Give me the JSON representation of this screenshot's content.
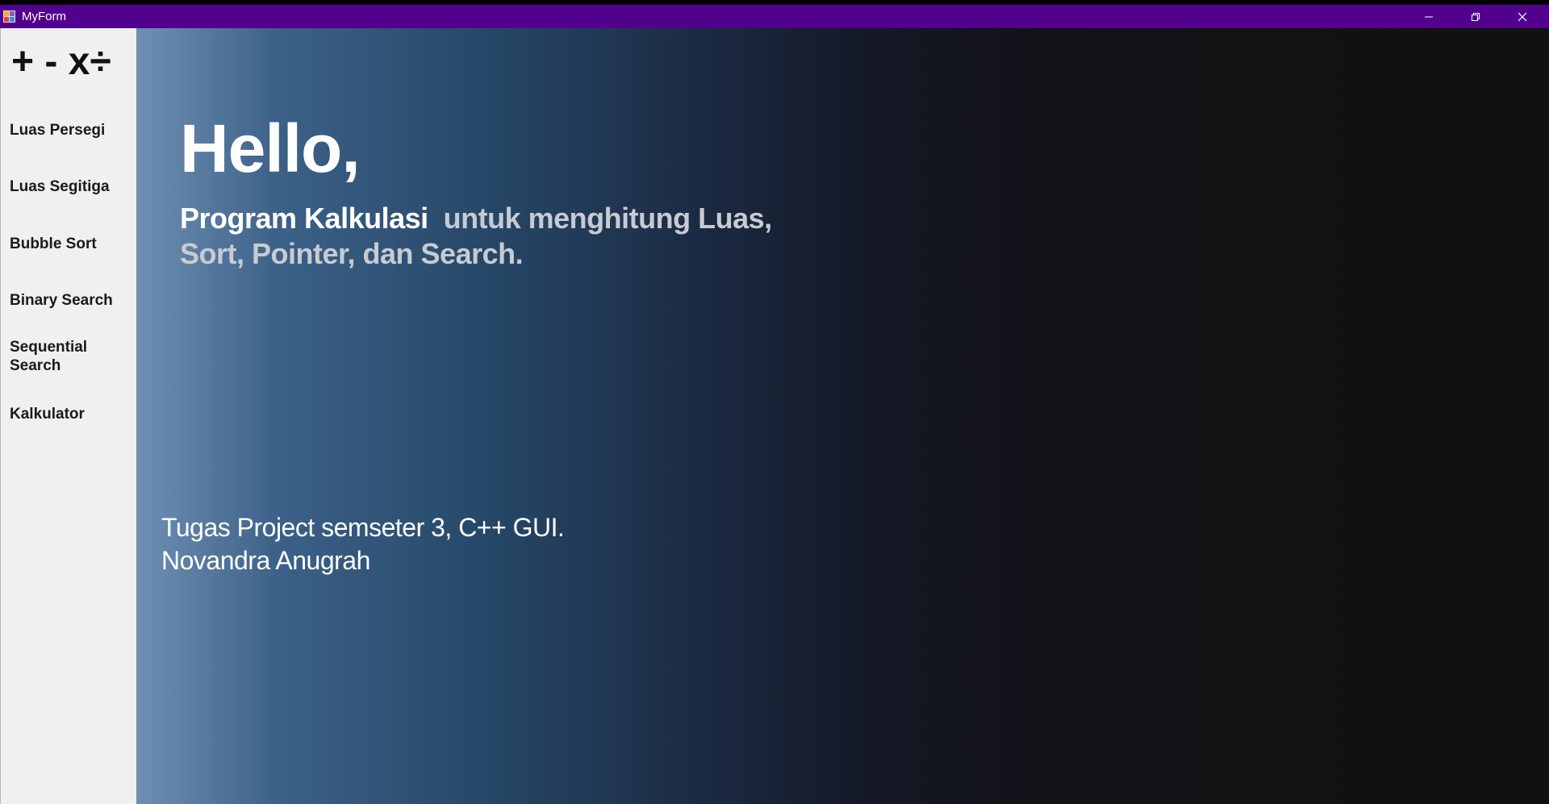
{
  "window": {
    "title": "MyForm",
    "colors": {
      "titlebar": "#52008e",
      "sidebar": "#f0f0f0",
      "main_dark": "#111111",
      "main_light": "#6f90b4"
    },
    "controls": {
      "minimize_icon": "minimize-icon",
      "maximize_icon": "restore-icon",
      "close_icon": "close-icon"
    }
  },
  "sidebar": {
    "logo": "+ - x÷",
    "items": [
      {
        "label": "Luas Persegi"
      },
      {
        "label": "Luas Segitiga"
      },
      {
        "label": "Bubble Sort"
      },
      {
        "label": "Binary Search"
      },
      {
        "label": "Sequential Search"
      },
      {
        "label": "Kalkulator"
      }
    ]
  },
  "main": {
    "greeting": "Hello,",
    "description_strong": "Program Kalkulasi",
    "description_rest": "untuk menghitung Luas, Sort, Pointer, dan Search.",
    "footer_line1": "Tugas Project semseter 3, C++ GUI.",
    "footer_line2": "Novandra Anugrah"
  }
}
